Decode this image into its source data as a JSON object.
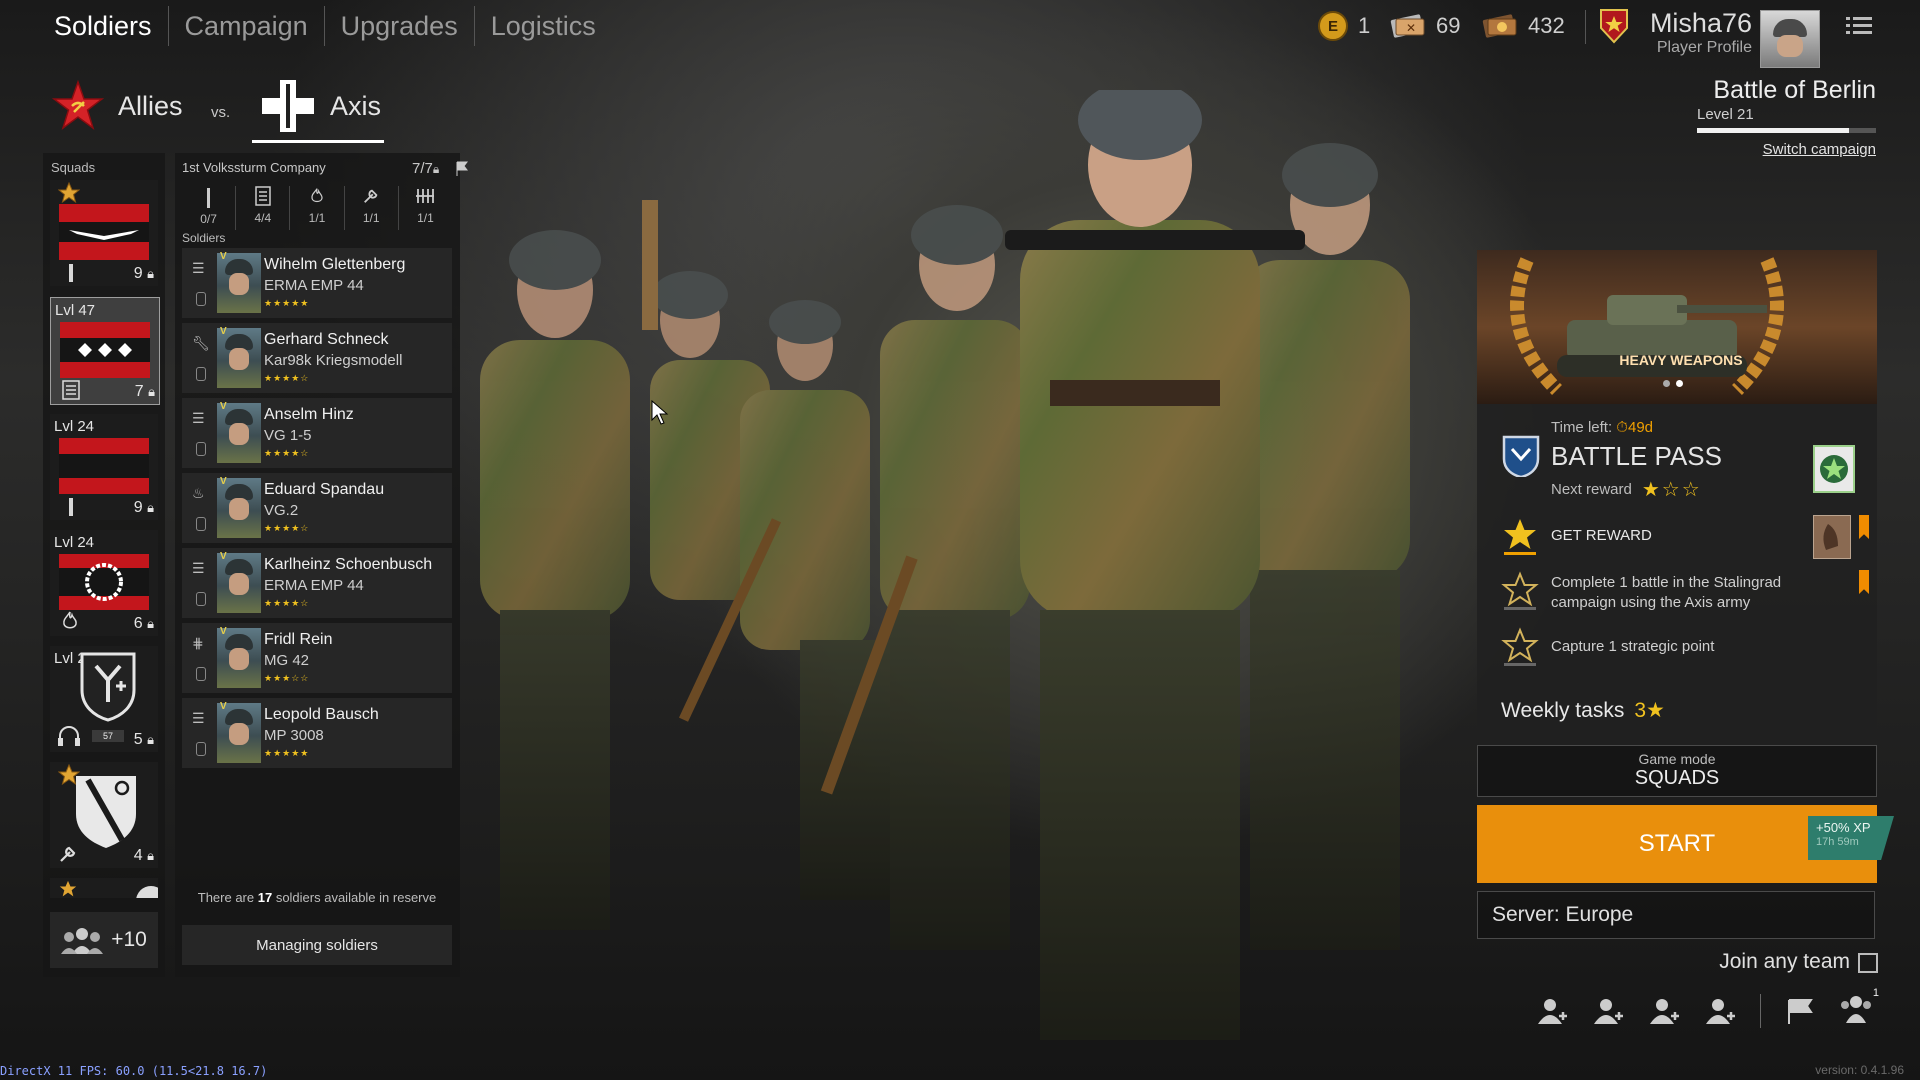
{
  "nav": {
    "tabs": [
      {
        "label": "Soldiers"
      },
      {
        "label": "Campaign"
      },
      {
        "label": "Upgrades"
      },
      {
        "label": "Logistics"
      }
    ]
  },
  "resources": {
    "enlisted_coin": "1",
    "silver_tickets": "69",
    "gold_tickets": "432",
    "coin_icon_letter": "E"
  },
  "profile": {
    "name": "Misha76",
    "subtitle": "Player Profile"
  },
  "campaign": {
    "name": "Battle of Berlin",
    "level": "Level 21",
    "switch_label": "Switch campaign",
    "progress": 0.85
  },
  "faction": {
    "allies_label": "Allies",
    "vs_label": "vs.",
    "axis_label": "Axis",
    "selected": "Axis"
  },
  "squads": {
    "header": "Squads",
    "items": [
      {
        "level": "",
        "count": "9"
      },
      {
        "level": "Lvl 47",
        "count": "7"
      },
      {
        "level": "Lvl 24",
        "count": "9"
      },
      {
        "level": "Lvl 24",
        "count": "6"
      },
      {
        "level": "Lvl 24",
        "count": "5"
      },
      {
        "level": "",
        "count": "4"
      }
    ],
    "reserve_label": "+10"
  },
  "company": {
    "name": "1st Volkssturm Company",
    "capacity": "7/7",
    "soldiers_header": "Soldiers",
    "class_slots": [
      {
        "value": "0/7"
      },
      {
        "value": "4/4"
      },
      {
        "value": "1/1"
      },
      {
        "value": "1/1"
      },
      {
        "value": "1/1"
      }
    ],
    "soldiers": [
      {
        "name": "Wihelm Glettenberg",
        "weapon": "ERMA EMP 44",
        "stars": "★★★★★"
      },
      {
        "name": "Gerhard Schneck",
        "weapon": "Kar98k Kriegsmodell",
        "stars": "★★★★☆"
      },
      {
        "name": "Anselm Hinz",
        "weapon": "VG 1-5",
        "stars": "★★★★☆"
      },
      {
        "name": "Eduard Spandau",
        "weapon": "VG.2",
        "stars": "★★★★☆"
      },
      {
        "name": "Karlheinz Schoenbusch",
        "weapon": "ERMA EMP 44",
        "stars": "★★★★☆"
      },
      {
        "name": "Fridl Rein",
        "weapon": "MG 42",
        "stars": "★★★☆☆"
      },
      {
        "name": "Leopold Bausch",
        "weapon": "MP 3008",
        "stars": "★★★★★"
      }
    ],
    "reserve_prefix": "There are ",
    "reserve_count": "17",
    "reserve_suffix": " soldiers available in reserve",
    "manage_label": "Managing soldiers"
  },
  "promo": {
    "label": "HEAVY WEAPONS",
    "page": 2,
    "pages": 2
  },
  "battle_pass": {
    "time_left_label": "Time left:",
    "time_left_value": "49d",
    "title": "BATTLE PASS",
    "next_reward_label": "Next reward",
    "next_reward_stars": 1,
    "next_reward_max": 3,
    "tasks": [
      {
        "text": "GET REWARD"
      },
      {
        "text": "Complete 1 battle in the Stalingrad campaign using the Axis army"
      },
      {
        "text": "Capture 1 strategic point"
      }
    ],
    "weekly_label": "Weekly tasks",
    "weekly_count": "3"
  },
  "game_mode": {
    "label": "Game mode",
    "value": "SQUADS"
  },
  "start": {
    "label": "START",
    "bonus_label": "+50% XP",
    "bonus_time": "17h 59m"
  },
  "server": {
    "label": "Server: Europe"
  },
  "join_any_team": {
    "label": "Join any team",
    "checked": false
  },
  "party": {
    "count_badge": "1"
  },
  "debug": {
    "fps": "DirectX 11 FPS: 60.0 (11.5<21.8 16.7)",
    "version": "version: 0.4.1.96"
  },
  "colors": {
    "accent": "#e98f0c",
    "star": "#f0c11f",
    "squad_red": "#c3161c",
    "bonus_teal": "#2e7d6c"
  }
}
